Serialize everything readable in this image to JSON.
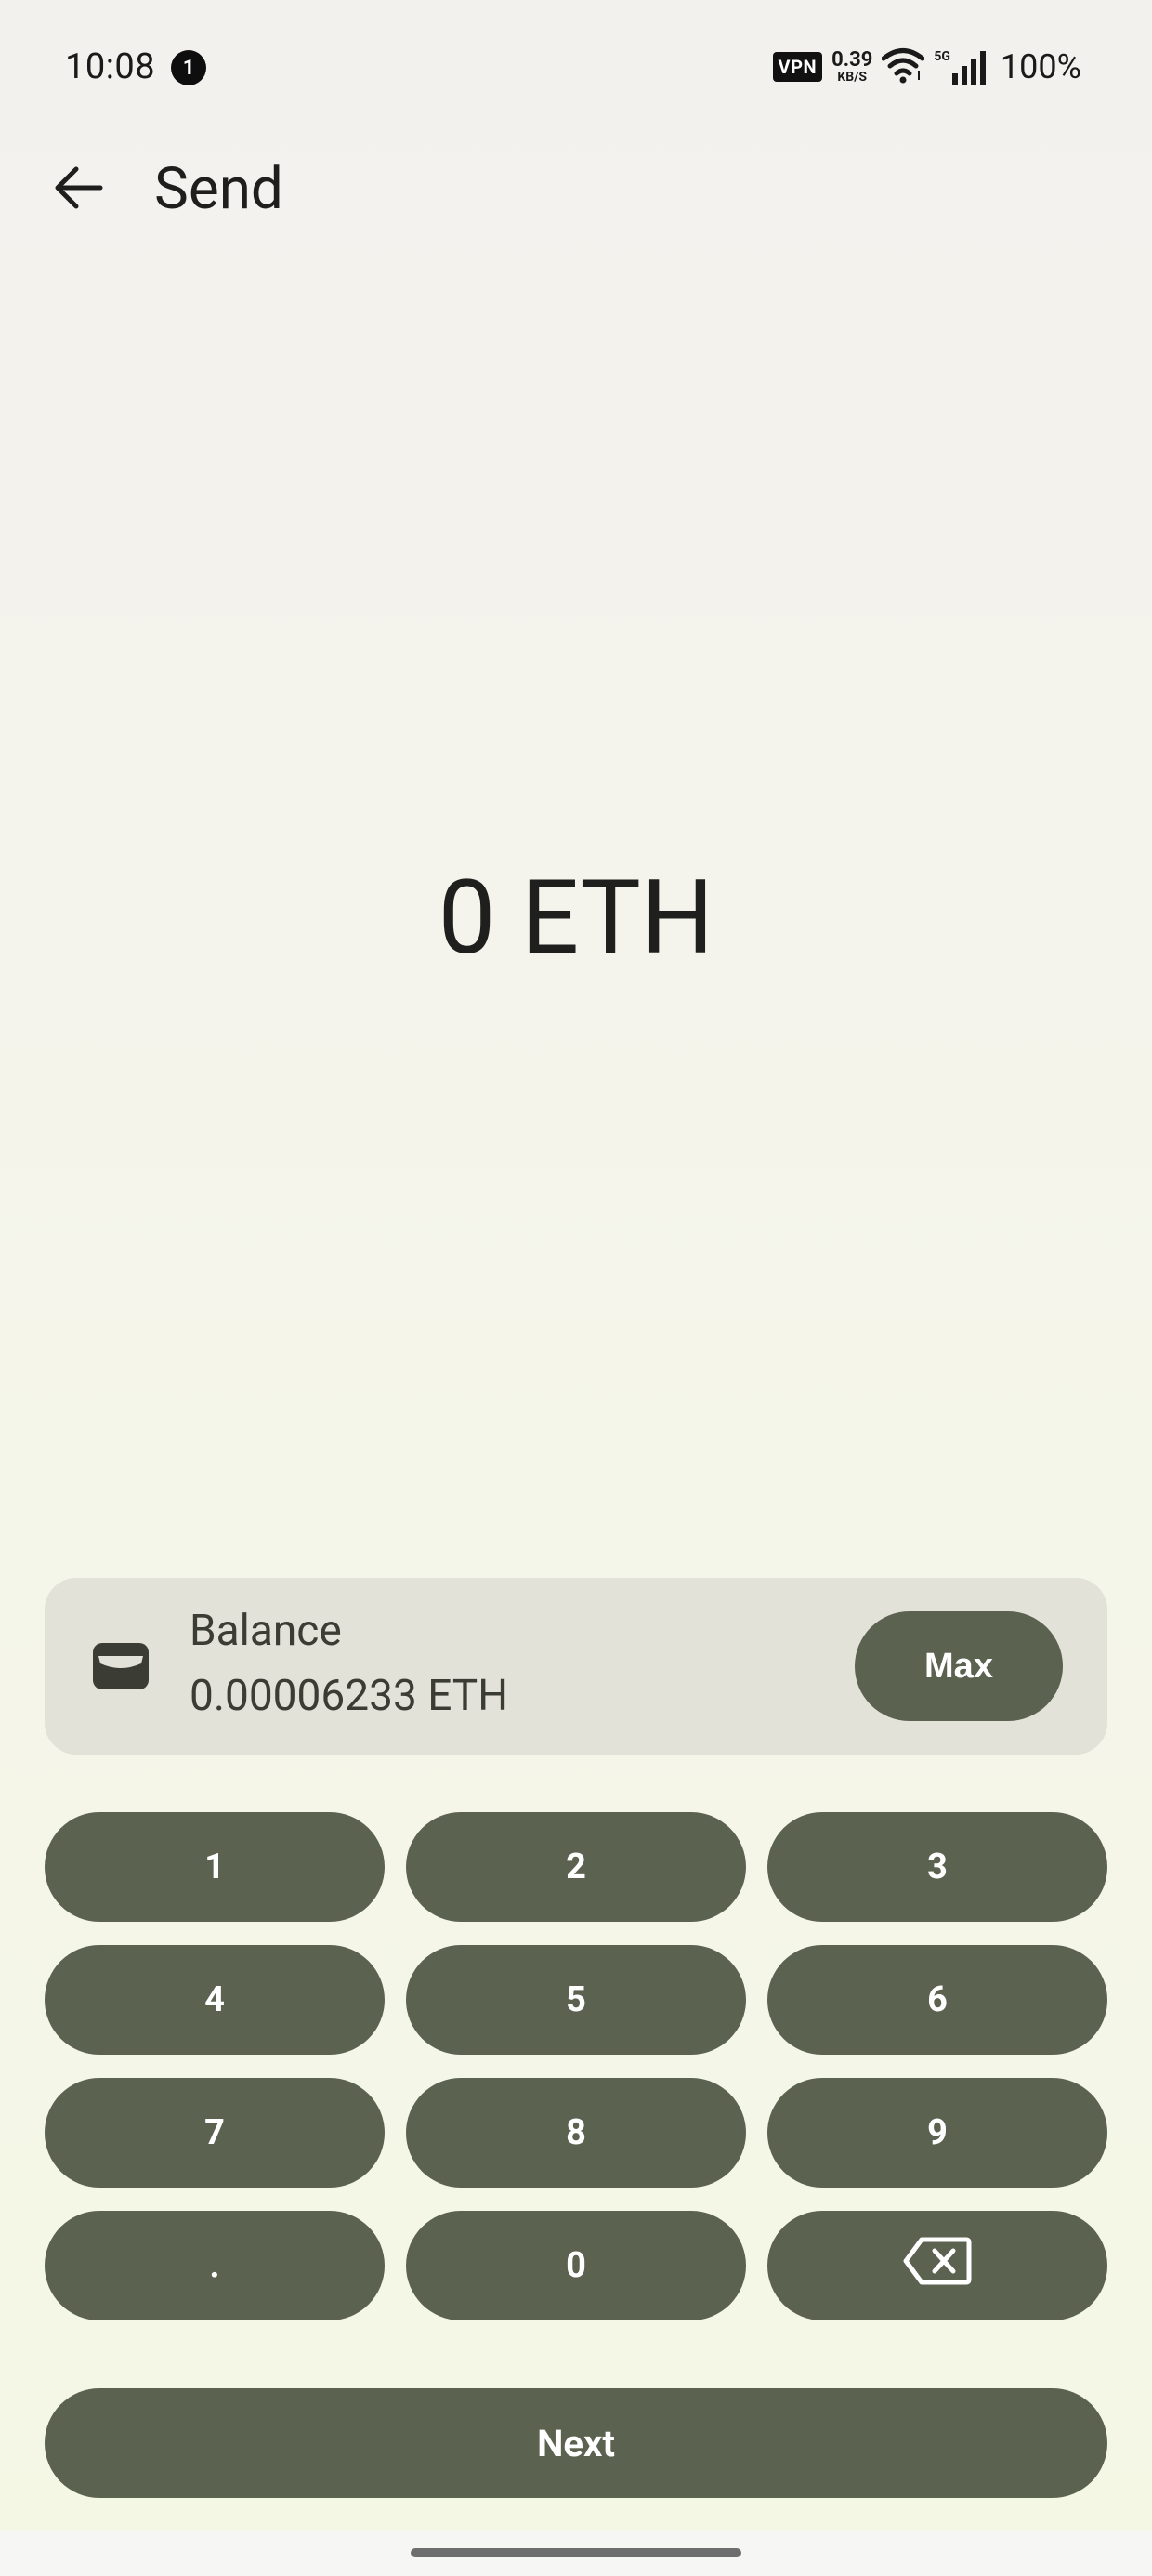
{
  "status_bar": {
    "time": "10:08",
    "notification_count": "1",
    "vpn_label": "VPN",
    "net_speed_value": "0.39",
    "net_speed_unit": "KB/S",
    "network_type": "5G",
    "battery": "100%"
  },
  "header": {
    "back_icon": "arrow-back-icon",
    "title": "Send"
  },
  "amount": {
    "display": "0 ETH"
  },
  "balance": {
    "icon": "wallet-icon",
    "label": "Balance",
    "value": "0.00006233 ETH",
    "max_label": "Max"
  },
  "keypad": {
    "keys": [
      "1",
      "2",
      "3",
      "4",
      "5",
      "6",
      "7",
      "8",
      "9",
      ".",
      "0"
    ],
    "backspace_icon": "backspace-icon"
  },
  "actions": {
    "next_label": "Next"
  },
  "colors": {
    "button_bg": "#5b6250",
    "card_bg": "#e2e2d9",
    "text_primary": "#1f1f1d"
  }
}
